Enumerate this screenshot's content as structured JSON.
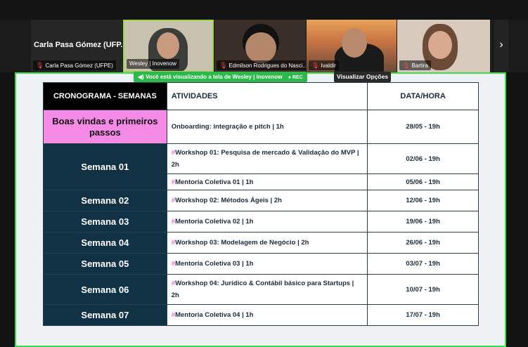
{
  "participants": [
    {
      "tile_title": "Carla Pasa Gómez (UFP...",
      "name": "Carla Pasa Gómez (UFPE)",
      "muted": true
    },
    {
      "name": "Wesley | Inovenow",
      "muted": false,
      "active_speaker": true
    },
    {
      "name": "Edmilson Rodrigues do Nasci...",
      "muted": true
    },
    {
      "name": "Ivaldir",
      "muted": true
    },
    {
      "name": "Bartira",
      "muted": true
    }
  ],
  "next_icon": "chevron-right-icon",
  "share_banner": {
    "text_prefix": "Você está visualizando a tela de",
    "presenter": "Wesley | Inovenow",
    "rec": "REC"
  },
  "view_options_label": "Visualizar Opções",
  "colors": {
    "share_border": "#3ddc4a",
    "banner_bg": "#2db84b",
    "week_cell": "#113245",
    "boas_vindas_cell": "#f58be6",
    "hash_accent": "#e96bd6"
  },
  "schedule": {
    "headers": {
      "weeks": "CRONOGRAMA - SEMANAS",
      "activities": "ATIVIDADES",
      "datetime": "DATA/HORA"
    },
    "rows": [
      {
        "week": "Boas vindas e primeiros passos",
        "activity": "Onboarding: integração e pitch | 1h",
        "hash": false,
        "date": "28/05 - 19h"
      },
      {
        "week": "Semana 01",
        "activity": "Workshop 01: Pesquisa de mercado & Validação do MVP | 2h",
        "hash": true,
        "date": "02/06 - 19h"
      },
      {
        "week": "",
        "activity": "Mentoria Coletiva 01 | 1h",
        "hash": true,
        "date": "05/06 - 19h"
      },
      {
        "week": "Semana 02",
        "activity": "Workshop 02: Métodos Ágeis | 2h",
        "hash": true,
        "date": "12/06 - 19h"
      },
      {
        "week": "Semana 03",
        "activity": "Mentoria Coletiva 02 | 1h",
        "hash": true,
        "date": "19/06 - 19h"
      },
      {
        "week": "Semana 04",
        "activity": "Workshop 03: Modelagem de Negócio | 2h",
        "hash": true,
        "date": "26/06 - 19h"
      },
      {
        "week": "Semana 05",
        "activity": "Mentoria Coletiva 03 | 1h",
        "hash": true,
        "date": "03/07 - 19h"
      },
      {
        "week": "Semana 06",
        "activity": "Workshop 04: Jurídico & Contábil básico para Startups | 2h",
        "hash": true,
        "date": "10/07 - 19h"
      },
      {
        "week": "Semana 07",
        "activity": "Mentoria Coletiva 04 | 1h",
        "hash": true,
        "date": "17/07 - 19h"
      }
    ]
  }
}
